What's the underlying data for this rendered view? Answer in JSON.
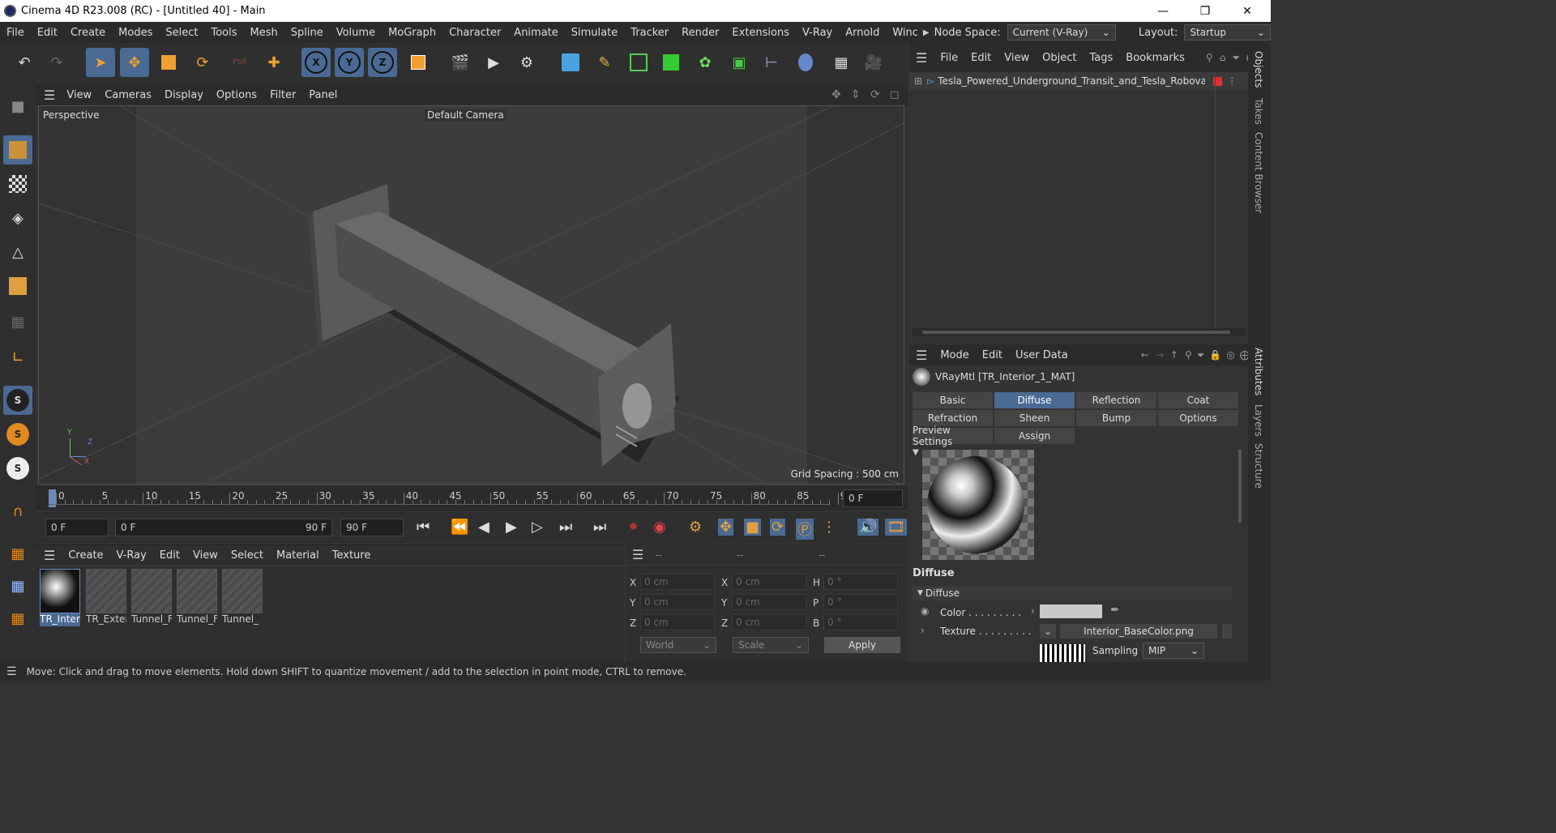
{
  "window": {
    "title": "Cinema 4D R23.008 (RC) - [Untitled 40] - Main"
  },
  "menu": [
    "File",
    "Edit",
    "Create",
    "Modes",
    "Select",
    "Tools",
    "Mesh",
    "Spline",
    "Volume",
    "MoGraph",
    "Character",
    "Animate",
    "Simulate",
    "Tracker",
    "Render",
    "Extensions",
    "V-Ray",
    "Arnold",
    "Winc"
  ],
  "node_space": {
    "label": "Node Space:",
    "value": "Current (V-Ray)"
  },
  "layout": {
    "label": "Layout:",
    "value": "Startup"
  },
  "viewport": {
    "menu": [
      "View",
      "Cameras",
      "Display",
      "Options",
      "Filter",
      "Panel"
    ],
    "label": "Perspective",
    "camera": "Default Camera",
    "grid": "Grid Spacing : 500 cm",
    "axis": {
      "x": "X",
      "y": "Y",
      "z": "Z"
    }
  },
  "timeline": {
    "ticks": [
      "0",
      "5",
      "10",
      "15",
      "20",
      "25",
      "30",
      "35",
      "40",
      "45",
      "50",
      "55",
      "60",
      "65",
      "70",
      "75",
      "80",
      "85",
      "90"
    ],
    "current": "0 F"
  },
  "transport": {
    "start": "0 F",
    "range_start": "0 F",
    "range_end": "90 F",
    "end": "90 F"
  },
  "materials": {
    "menu": [
      "Create",
      "V-Ray",
      "Edit",
      "View",
      "Select",
      "Material",
      "Texture"
    ],
    "items": [
      "TR_Inter",
      "TR_Exter",
      "Tunnel_F",
      "Tunnel_F",
      "Tunnel_"
    ]
  },
  "coords": {
    "headers": [
      "--",
      "--",
      "--"
    ],
    "rows": [
      [
        "X",
        "0 cm",
        "X",
        "0 cm",
        "H",
        "0 °"
      ],
      [
        "Y",
        "0 cm",
        "Y",
        "0 cm",
        "P",
        "0 °"
      ],
      [
        "Z",
        "0 cm",
        "Z",
        "0 cm",
        "B",
        "0 °"
      ]
    ],
    "mode1": "World",
    "mode2": "Scale",
    "apply": "Apply"
  },
  "objects": {
    "menu": [
      "File",
      "Edit",
      "View",
      "Object",
      "Tags",
      "Bookmarks"
    ],
    "item": "Tesla_Powered_Underground_Transit_and_Tesla_Robovan_g"
  },
  "attributes": {
    "menu": [
      "Mode",
      "Edit",
      "User Data"
    ],
    "material": "VRayMtl [TR_Interior_1_MAT]",
    "tabs": [
      "Basic",
      "Diffuse",
      "Reflection",
      "Coat",
      "Refraction",
      "Sheen",
      "Bump",
      "Options",
      "Preview Settings",
      "Assign"
    ],
    "section": "Diffuse",
    "group": "Diffuse",
    "color_label": "Color . . . . . . . . .",
    "texture_label": "Texture . . . . . . . . .",
    "texture_file": "Interior_BaseColor.png",
    "sampling_label": "Sampling",
    "sampling_value": "MIP"
  },
  "right_tabs": [
    "Objects",
    "Takes",
    "Content Browser",
    "Attributes",
    "Layers",
    "Structure"
  ],
  "status": "Move: Click and drag to move elements. Hold down SHIFT to quantize movement / add to the selection in point mode, CTRL to remove."
}
